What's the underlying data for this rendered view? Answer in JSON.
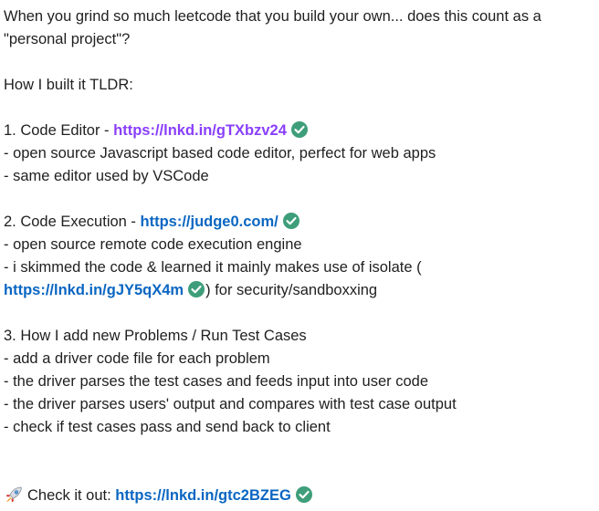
{
  "post": {
    "intro": "When you grind so much leetcode that you build your own... does this count as a \"personal project\"?",
    "tldr": "How I built it TLDR:",
    "item1": {
      "prefix": "1. Code Editor - ",
      "link": "https://lnkd.in/gTXbzv24",
      "bullets": [
        "- open source Javascript based code editor, perfect for web apps",
        "- same editor used by VSCode"
      ]
    },
    "item2": {
      "prefix": "2. Code Execution - ",
      "link": "https://judge0.com/",
      "bullet1": "- open source remote code execution engine",
      "bullet2_a": "- i skimmed the code & learned it mainly makes use of isolate (",
      "bullet2_link": "https://lnkd.in/gJY5qX4m",
      "bullet2_b": ") for security/sandboxxing"
    },
    "item3": {
      "title": "3. How I add new Problems / Run Test Cases",
      "bullets": [
        "- add a driver code file for each problem",
        "- the driver parses the test cases and feeds input into user code",
        "- the driver parses users' output and compares with test case output",
        "- check if test cases pass and send back to client"
      ]
    },
    "cta": {
      "label": "Check it out: ",
      "link": "https://lnkd.in/gtc2BZEG"
    }
  },
  "icons": {
    "check": "check-circle-icon",
    "rocket": "rocket-icon"
  },
  "colors": {
    "link": "#0a66c2",
    "visited_link": "#8a3ffc",
    "check": "#3e9e7a"
  }
}
